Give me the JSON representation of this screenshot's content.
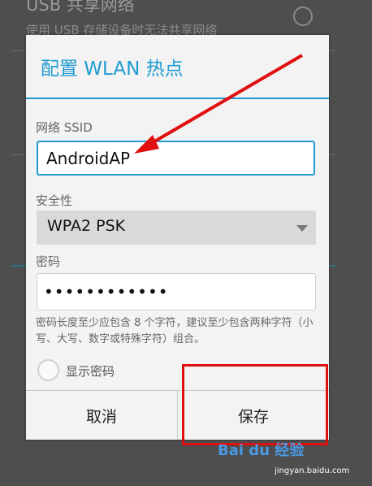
{
  "background": {
    "usb_title": "USB 共享网络",
    "usb_subtitle": "使用 USB 存储设备时无法共享网络"
  },
  "dialog": {
    "title": "配置 WLAN 热点",
    "ssid_label": "网络 SSID",
    "ssid_value": "AndroidAP",
    "security_label": "安全性",
    "security_value": "WPA2 PSK",
    "password_label": "密码",
    "password_value": "••••••••••••",
    "hint": "密码长度至少应包含 8 个字符，建议至少包含两种字符（小写、大写、数字或特殊字符）组合。",
    "show_password_label": "显示密码",
    "show_password_checked": false,
    "cancel_label": "取消",
    "save_label": "保存"
  },
  "colors": {
    "accent": "#1f9ad0",
    "annotation": "#e01010"
  },
  "watermark": {
    "brand": "Bai du 经验",
    "url": "jingyan.baidu.com"
  }
}
